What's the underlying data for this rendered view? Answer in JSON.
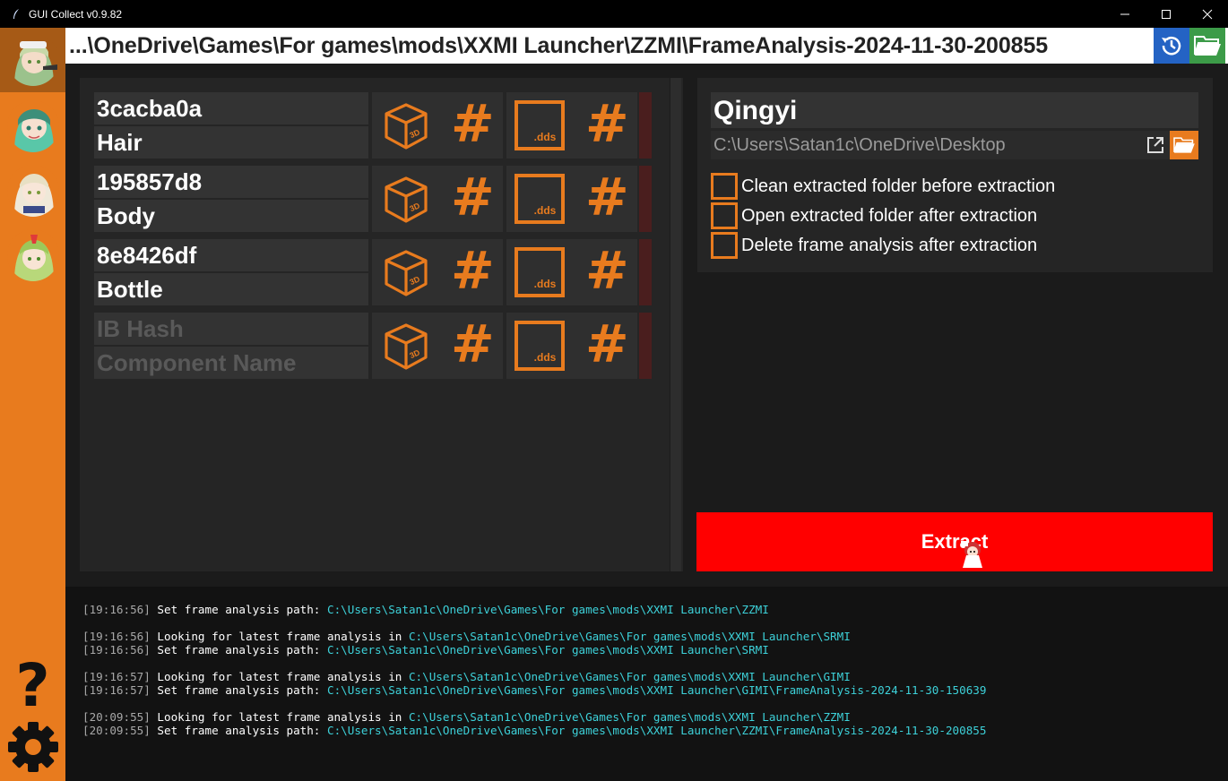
{
  "window": {
    "title": "GUI Collect v0.9.82"
  },
  "path_bar": {
    "path": "...\\OneDrive\\Games\\For games\\mods\\XXMI Launcher\\ZZMI\\FrameAnalysis-2024-11-30-200855"
  },
  "components": [
    {
      "ib_hash": "3cacba0a",
      "name": "Hair",
      "placeholder": false
    },
    {
      "ib_hash": "195857d8",
      "name": "Body",
      "placeholder": false
    },
    {
      "ib_hash": "8e8426df",
      "name": "Bottle",
      "placeholder": false
    },
    {
      "ib_hash": "IB Hash",
      "name": "Component Name",
      "placeholder": true
    }
  ],
  "icons": {
    "cube_label": "3D",
    "texture_label": ".dds",
    "hash_glyph": "#"
  },
  "right": {
    "character_name": "Qingyi",
    "output_path": "C:\\Users\\Satan1c\\OneDrive\\Desktop",
    "options": [
      {
        "label": "Clean extracted folder before extraction",
        "checked": false
      },
      {
        "label": "Open extracted folder after extraction",
        "checked": false
      },
      {
        "label": "Delete frame analysis after extraction",
        "checked": false
      }
    ],
    "extract_label": "Extract"
  },
  "sidebar": {
    "help_glyph": "?"
  },
  "log": [
    {
      "ts": "[19:16:56]",
      "msg": "Set frame analysis path: ",
      "path": "C:\\Users\\Satan1c\\OneDrive\\Games\\For games\\mods\\XXMI Launcher\\ZZMI"
    },
    {
      "ts": "[19:16:56]",
      "msg": "Looking for latest frame analysis in ",
      "path": "C:\\Users\\Satan1c\\OneDrive\\Games\\For games\\mods\\XXMI Launcher\\SRMI"
    },
    {
      "ts": "[19:16:56]",
      "msg": "Set frame analysis path: ",
      "path": "C:\\Users\\Satan1c\\OneDrive\\Games\\For games\\mods\\XXMI Launcher\\SRMI"
    },
    {
      "ts": "[19:16:57]",
      "msg": "Looking for latest frame analysis in ",
      "path": "C:\\Users\\Satan1c\\OneDrive\\Games\\For games\\mods\\XXMI Launcher\\GIMI"
    },
    {
      "ts": "[19:16:57]",
      "msg": "Set frame analysis path: ",
      "path": "C:\\Users\\Satan1c\\OneDrive\\Games\\For games\\mods\\XXMI Launcher\\GIMI\\FrameAnalysis-2024-11-30-150639"
    },
    {
      "ts": "[20:09:55]",
      "msg": "Looking for latest frame analysis in ",
      "path": "C:\\Users\\Satan1c\\OneDrive\\Games\\For games\\mods\\XXMI Launcher\\ZZMI"
    },
    {
      "ts": "[20:09:55]",
      "msg": "Set frame analysis path: ",
      "path": "C:\\Users\\Satan1c\\OneDrive\\Games\\For games\\mods\\XXMI Launcher\\ZZMI\\FrameAnalysis-2024-11-30-200855"
    }
  ],
  "colors": {
    "accent": "#e87b1e",
    "extract": "#ff0000",
    "history": "#2463c4",
    "folder": "#3c9b48",
    "log_path": "#3dd1d9"
  }
}
